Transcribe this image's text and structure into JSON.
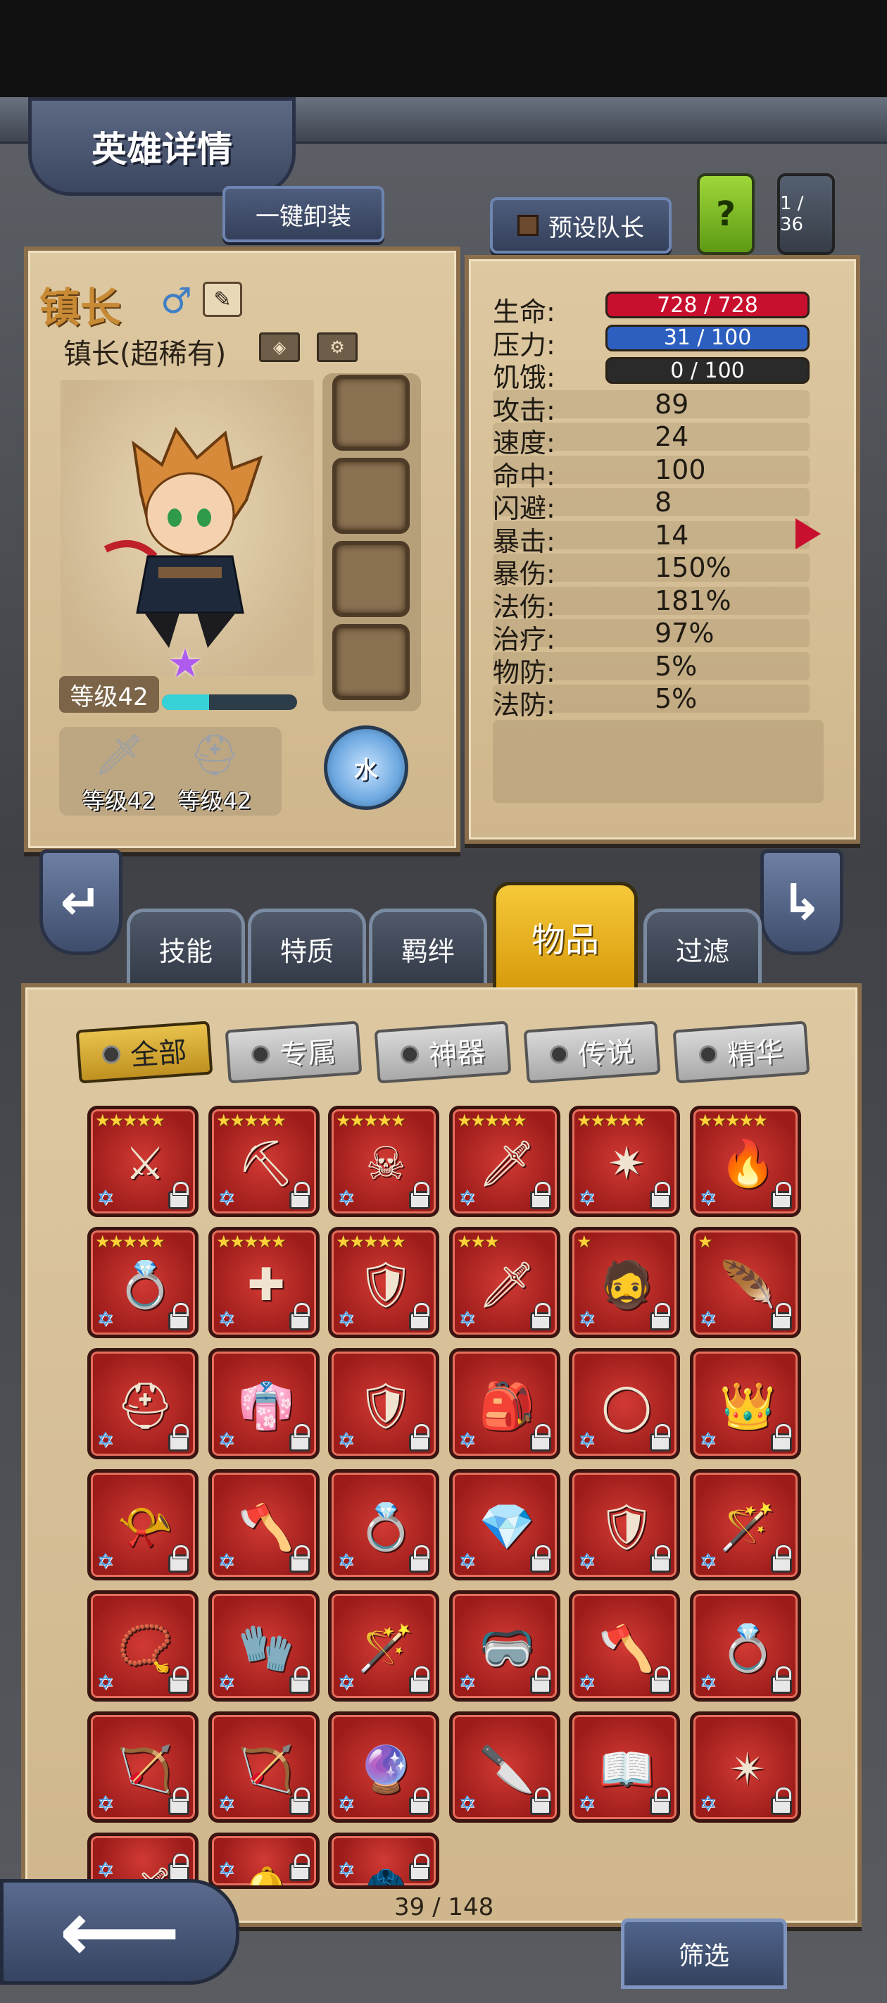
{
  "header": {
    "title": "英雄详情"
  },
  "top_buttons": {
    "unequip_all": "一键卸装",
    "preset_leader": "预设队长",
    "help": "?",
    "roster_count": "1 / 36"
  },
  "hero": {
    "name": "镇长",
    "gender_symbol": "♂",
    "class_label": "镇长(超稀有)",
    "level_label": "等级42",
    "xp_progress": 0.35,
    "weapon_level": "等级42",
    "armor_level": "等级42",
    "element": "水"
  },
  "stats": [
    {
      "label": "生命:",
      "value": "728 / 728",
      "bar": "red"
    },
    {
      "label": "压力:",
      "value": "31 / 100",
      "bar": "blue"
    },
    {
      "label": "饥饿:",
      "value": "0 / 100",
      "bar": "dark"
    },
    {
      "label": "攻击:",
      "value": "89"
    },
    {
      "label": "速度:",
      "value": "24"
    },
    {
      "label": "命中:",
      "value": "100"
    },
    {
      "label": "闪避:",
      "value": "8"
    },
    {
      "label": "暴击:",
      "value": "14"
    },
    {
      "label": "暴伤:",
      "value": "150%"
    },
    {
      "label": "法伤:",
      "value": "181%"
    },
    {
      "label": "治疗:",
      "value": "97%"
    },
    {
      "label": "物防:",
      "value": "5%"
    },
    {
      "label": "法防:",
      "value": "5%"
    }
  ],
  "tabs": [
    "技能",
    "特质",
    "羁绊",
    "物品",
    "过滤"
  ],
  "active_tab": "物品",
  "filters": [
    "全部",
    "专属",
    "神器",
    "传说",
    "精华"
  ],
  "items": [
    {
      "stars": "★★★★★",
      "icon": "⚔"
    },
    {
      "stars": "★★★★★",
      "icon": "⛏"
    },
    {
      "stars": "★★★★★",
      "icon": "☠"
    },
    {
      "stars": "★★★★★",
      "icon": "🗡"
    },
    {
      "stars": "★★★★★",
      "icon": "✷"
    },
    {
      "stars": "★★★★★",
      "icon": "🔥"
    },
    {
      "stars": "★★★★★",
      "icon": "💍"
    },
    {
      "stars": "★★★★★",
      "icon": "✚"
    },
    {
      "stars": "★★★★★",
      "icon": "🛡"
    },
    {
      "stars": "★★★",
      "icon": "🗡"
    },
    {
      "stars": "★",
      "icon": "🧔"
    },
    {
      "stars": "★",
      "icon": "🪶"
    },
    {
      "stars": "",
      "icon": "⛑"
    },
    {
      "stars": "",
      "icon": "👘"
    },
    {
      "stars": "",
      "icon": "🛡"
    },
    {
      "stars": "",
      "icon": "🎒"
    },
    {
      "stars": "",
      "icon": "◯"
    },
    {
      "stars": "",
      "icon": "👑"
    },
    {
      "stars": "",
      "icon": "📯"
    },
    {
      "stars": "",
      "icon": "🪓"
    },
    {
      "stars": "",
      "icon": "💍"
    },
    {
      "stars": "",
      "icon": "💎"
    },
    {
      "stars": "",
      "icon": "🛡"
    },
    {
      "stars": "",
      "icon": "🪄"
    },
    {
      "stars": "",
      "icon": "📿"
    },
    {
      "stars": "",
      "icon": "🧤"
    },
    {
      "stars": "",
      "icon": "🪄"
    },
    {
      "stars": "",
      "icon": "🥽"
    },
    {
      "stars": "",
      "icon": "🪓"
    },
    {
      "stars": "",
      "icon": "💍"
    },
    {
      "stars": "",
      "icon": "🏹"
    },
    {
      "stars": "",
      "icon": "🏹"
    },
    {
      "stars": "",
      "icon": "🔮"
    },
    {
      "stars": "",
      "icon": "🔪"
    },
    {
      "stars": "",
      "icon": "📖"
    },
    {
      "stars": "",
      "icon": "✴"
    },
    {
      "stars": "",
      "icon": "🗡"
    },
    {
      "stars": "",
      "icon": "🔔"
    },
    {
      "stars": "",
      "icon": "🧥"
    }
  ],
  "pagination": "39 / 148",
  "bottom": {
    "back_icon": "arrow-left-icon",
    "sift": "筛选"
  },
  "colors": {
    "accent": "#f2c12e",
    "parchment": "#d7c29b",
    "hp": "#c8102e",
    "stress": "#2c5fbf",
    "xp": "#36d2d8"
  }
}
